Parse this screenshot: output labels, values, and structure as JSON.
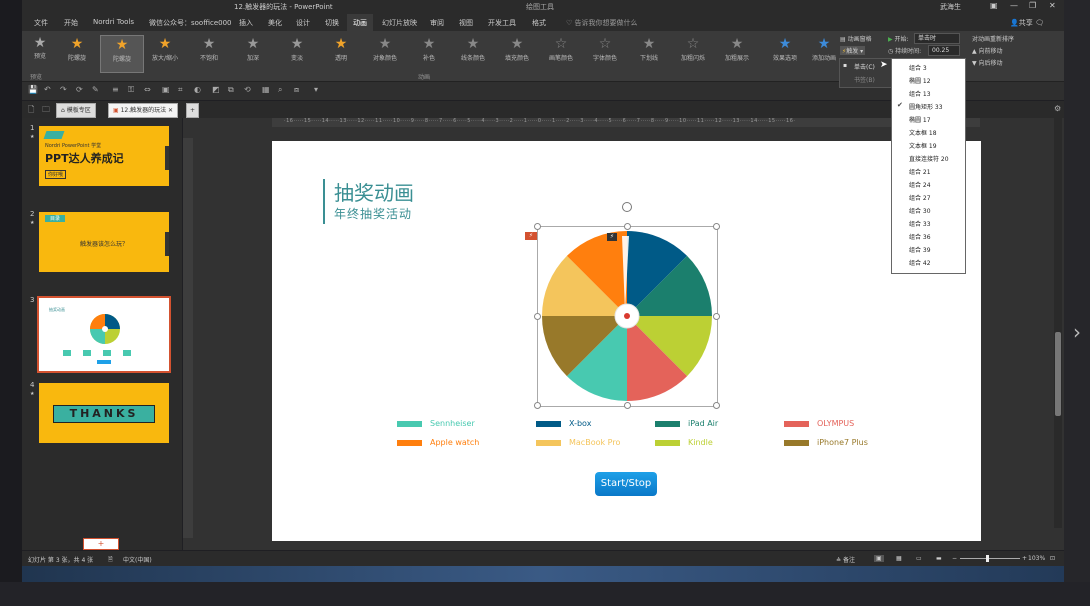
{
  "window": {
    "title": "12.触发器的玩法 - PowerPoint",
    "contextual_tab_group": "绘图工具",
    "user": "武海生",
    "share_label": "共享"
  },
  "tabs": [
    "文件",
    "开始",
    "Nordri Tools",
    "微信公众号：sooffice000",
    "插入",
    "美化",
    "设计",
    "切换",
    "动画",
    "幻灯片放映",
    "审阅",
    "视图",
    "开发工具",
    "格式"
  ],
  "active_tab": "动画",
  "tell_me_placeholder": "告诉我你想要做什么",
  "ribbon": {
    "preview_label": "预览",
    "preview_group": "预览",
    "animation_group": "动画",
    "effects": [
      "陀螺旋",
      "陀螺旋",
      "放大/缩小",
      "不饱和",
      "加深",
      "变淡",
      "透明",
      "对象颜色",
      "补色",
      "线条颜色",
      "填充颜色",
      "画笔颜色",
      "字体颜色",
      "下划线",
      "加粗闪烁",
      "加粗展示"
    ],
    "selected_effect_index": 1,
    "effect_options_label": "效果选项",
    "add_animation_label": "添加动画",
    "animation_pane_label": "动画窗格",
    "trigger_label": "触发",
    "start_label": "开始:",
    "start_value": "单击时",
    "duration_label": "持续时间:",
    "duration_value": "00.25",
    "reorder_label": "对动画重新排序",
    "move_earlier": "向前移动",
    "move_later": "向后移动"
  },
  "trigger_menu": {
    "items": [
      "单击(C)",
      "书签(B)"
    ]
  },
  "object_menu": {
    "items": [
      "组合 3",
      "椭圆 12",
      "组合 13",
      "圆角矩形 33",
      "椭圆 17",
      "文本框 18",
      "文本框 19",
      "直接连接符 20",
      "组合 21",
      "组合 24",
      "组合 27",
      "组合 30",
      "组合 33",
      "组合 36",
      "组合 39",
      "组合 42"
    ],
    "checked_index": 3
  },
  "doc_tabs": [
    "模板专区",
    "12.触发器的玩法"
  ],
  "thumbnails": [
    {
      "num": "1",
      "title": "PPT达人养成记",
      "subtitle": "Nordri PowerPoint 学堂",
      "tag": "你好哦"
    },
    {
      "num": "2",
      "title": "触发器该怎么玩？",
      "tag": "目录"
    },
    {
      "num": "3",
      "title": "抽奖动画"
    },
    {
      "num": "4",
      "title": "THANKS"
    }
  ],
  "slide": {
    "title": "抽奖动画",
    "subtitle": "年终抽奖活动",
    "trigger_badge": "⚡",
    "start_stop_label": "Start/Stop",
    "prizes": [
      {
        "name": "Sennheiser",
        "color": "#48c9b0"
      },
      {
        "name": "X-box",
        "color": "#005a87"
      },
      {
        "name": "iPad Air",
        "color": "#1b7f6d"
      },
      {
        "name": "OLYMPUS",
        "color": "#e4635a"
      },
      {
        "name": "Apple watch",
        "color": "#ff7f0e"
      },
      {
        "name": "MacBook Pro",
        "color": "#f4c55c"
      },
      {
        "name": "Kindle",
        "color": "#bcd034"
      },
      {
        "name": "iPhone7 Plus",
        "color": "#98792a"
      }
    ]
  },
  "status": {
    "slide_info": "幻灯片 第 3 张，共 4 张",
    "language": "中文(中国)",
    "notes_label": "备注",
    "zoom": "103%"
  }
}
